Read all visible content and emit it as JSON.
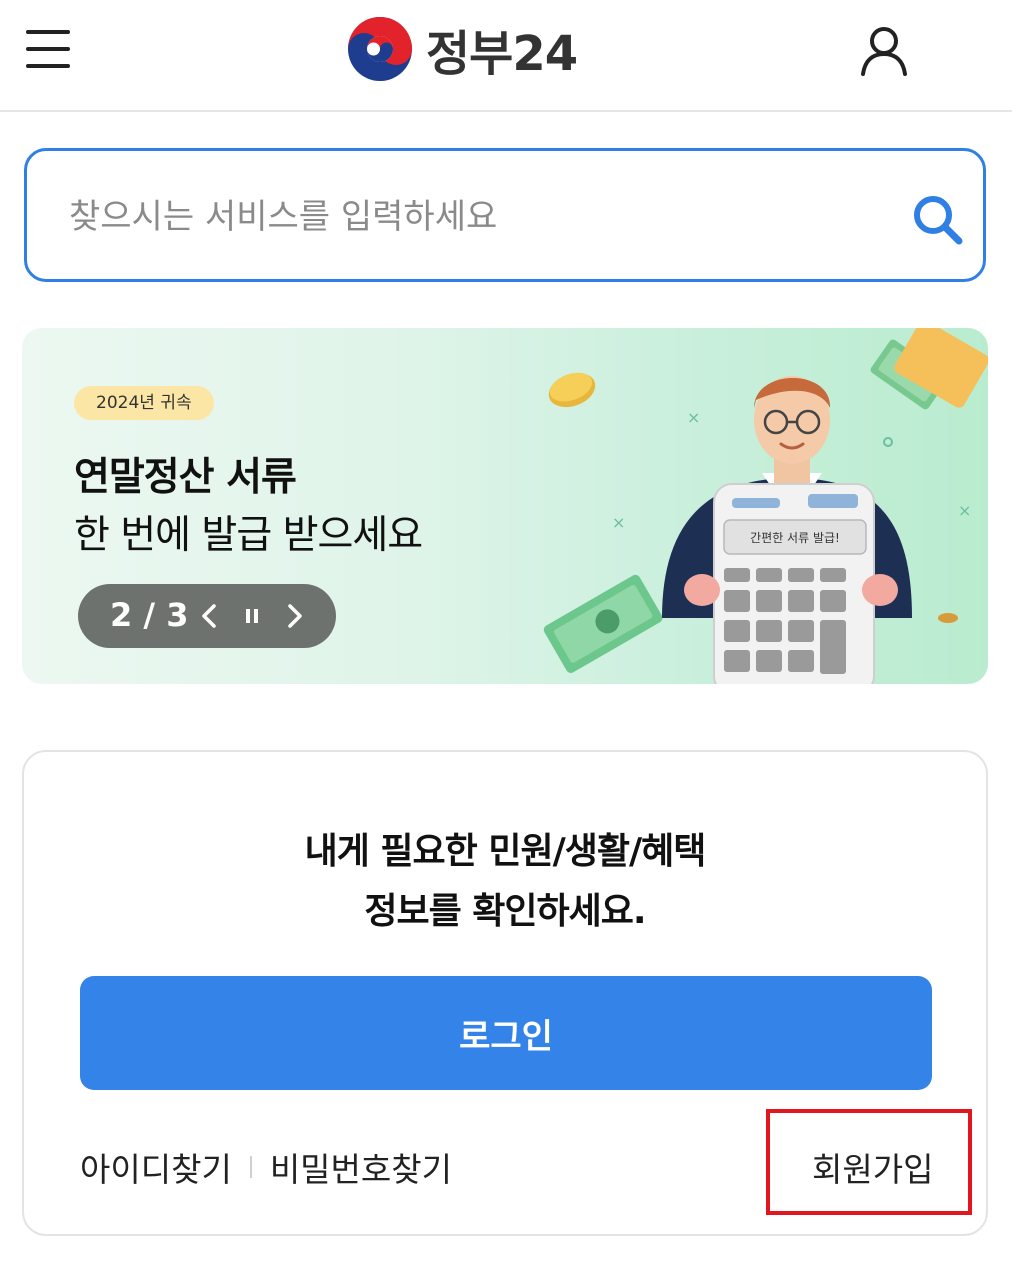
{
  "header": {
    "logo_text": "정부24",
    "menu_icon": "hamburger-menu-icon",
    "user_icon": "user-icon"
  },
  "search": {
    "placeholder": "찾으시는 서비스를 입력하세요",
    "value": "",
    "icon": "search-icon"
  },
  "banner": {
    "badge": "2024년 귀속",
    "title": "연말정산 서류",
    "subtitle": "한 번에 발급 받으세요",
    "pager": {
      "current": "2",
      "total": "3",
      "count_text": "2 / 3"
    },
    "calculator_text": "간편한 서류 발급!"
  },
  "login_card": {
    "title_line1": "내게 필요한 민원/생활/혜택",
    "title_line2": "정보를 확인하세요.",
    "login_button": "로그인",
    "find_id": "아이디찾기",
    "find_password": "비밀번호찾기",
    "signup": "회원가입"
  },
  "colors": {
    "accent": "#3383e8",
    "search_border": "#2f7fe4",
    "highlight_box": "#e3161f",
    "badge_bg": "#fbe6a6",
    "pager_bg": "#6e726f"
  }
}
